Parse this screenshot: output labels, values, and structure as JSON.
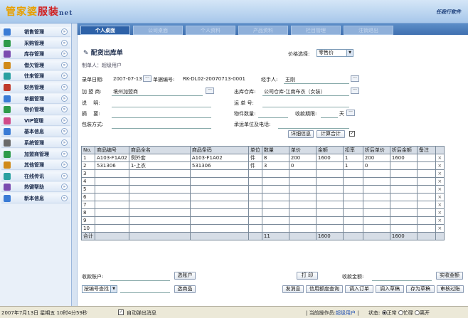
{
  "app": {
    "logo_part1": "管家婆",
    "logo_part2": "服装",
    "logo_part3": "net",
    "brand": "任我行软件"
  },
  "sidebar": {
    "items": [
      {
        "label": "销售管理",
        "icon": "sales-icon",
        "color": "#3a7bd5"
      },
      {
        "label": "采购管理",
        "icon": "purchase-icon",
        "color": "#2e9b4a"
      },
      {
        "label": "库存管理",
        "icon": "inventory-icon",
        "color": "#7a4bb0"
      },
      {
        "label": "借欠管理",
        "icon": "debt-icon",
        "color": "#d08a1a"
      },
      {
        "label": "往来管理",
        "icon": "exchange-icon",
        "color": "#2aa0a0"
      },
      {
        "label": "财务管理",
        "icon": "finance-icon",
        "color": "#c0392b"
      },
      {
        "label": "单据管理",
        "icon": "document-icon",
        "color": "#3a7bd5"
      },
      {
        "label": "物价管理",
        "icon": "price-icon",
        "color": "#2e9b4a"
      },
      {
        "label": "VIP管理",
        "icon": "vip-icon",
        "color": "#d04a8a"
      },
      {
        "label": "基本信息",
        "icon": "info-icon",
        "color": "#3a7bd5"
      },
      {
        "label": "系统管理",
        "icon": "system-icon",
        "color": "#6a6a6a"
      },
      {
        "label": "加盟商管理",
        "icon": "franchise-icon",
        "color": "#2e9b4a"
      },
      {
        "label": "其他管理",
        "icon": "other-icon",
        "color": "#d08a1a"
      },
      {
        "label": "在线传讯",
        "icon": "chat-icon",
        "color": "#2aa0a0"
      },
      {
        "label": "热键帮助",
        "icon": "help-icon",
        "color": "#7a4bb0"
      },
      {
        "label": "新本信息",
        "icon": "news-icon",
        "color": "#3a7bd5"
      }
    ]
  },
  "tabs": [
    {
      "label": "个人桌面",
      "active": true
    },
    {
      "label": "公司桌面",
      "active": false
    },
    {
      "label": "个人资料",
      "active": false
    },
    {
      "label": "产品资料",
      "active": false
    },
    {
      "label": "栏目管理",
      "active": false
    },
    {
      "label": "注销退出",
      "active": false
    }
  ],
  "form": {
    "title": "配货出库单",
    "price_label": "价格选择:",
    "price_value": "零售价",
    "creator": "制单人：超级用户",
    "date_label": "录单日期:",
    "date_value": "2007-07-13",
    "doc_no_label": "单据编号:",
    "doc_no_value": "RK-DL02-20070713-0001",
    "handler_label": "经手人:",
    "handler_value": "王刚",
    "franchise_label": "加 盟 商:",
    "franchise_value": "境州加盟商",
    "warehouse_label": "出库仓库:",
    "warehouse_value": "公司仓库-江南布衣（女装）",
    "desc_label": "说　 明:",
    "waybill_label": "运 单 号:",
    "summary_label": "摘　 要:",
    "qty_label": "物件数量:",
    "term_label": "收款期限:",
    "term_unit": "天",
    "packing_label": "包装方式:",
    "carrier_label": "承运单位及电话:",
    "detail_btn": "详细信息",
    "total_btn": "计算合计"
  },
  "grid": {
    "columns": [
      "No.",
      "商品编号",
      "商品全名",
      "商品条码",
      "单位",
      "数量",
      "单价",
      "金额",
      "扣率",
      "折后单价",
      "折后金额",
      "备注",
      ""
    ],
    "rows": [
      [
        "1",
        "A103-F1A02",
        "例外套",
        "A103-F1A02",
        "件",
        "8",
        "200",
        "1600",
        "1",
        "200",
        "1600",
        "",
        "×"
      ],
      [
        "2",
        "531306",
        "1-上衣",
        "531306",
        "件",
        "3",
        "0",
        "",
        "1",
        "0",
        "",
        "",
        "×"
      ],
      [
        "3",
        "",
        "",
        "",
        "",
        "",
        "",
        "",
        "",
        "",
        "",
        "",
        "×"
      ],
      [
        "4",
        "",
        "",
        "",
        "",
        "",
        "",
        "",
        "",
        "",
        "",
        "",
        "×"
      ],
      [
        "5",
        "",
        "",
        "",
        "",
        "",
        "",
        "",
        "",
        "",
        "",
        "",
        "×"
      ],
      [
        "6",
        "",
        "",
        "",
        "",
        "",
        "",
        "",
        "",
        "",
        "",
        "",
        "×"
      ],
      [
        "7",
        "",
        "",
        "",
        "",
        "",
        "",
        "",
        "",
        "",
        "",
        "",
        "×"
      ],
      [
        "8",
        "",
        "",
        "",
        "",
        "",
        "",
        "",
        "",
        "",
        "",
        "",
        "×"
      ],
      [
        "9",
        "",
        "",
        "",
        "",
        "",
        "",
        "",
        "",
        "",
        "",
        "",
        "×"
      ],
      [
        "10",
        "",
        "",
        "",
        "",
        "",
        "",
        "",
        "",
        "",
        "",
        "",
        "×"
      ]
    ],
    "total": [
      "合计",
      "",
      "",
      "",
      "",
      "11",
      "",
      "1600",
      "",
      "",
      "1600",
      "",
      ""
    ]
  },
  "bottom": {
    "account_label": "收款账户:",
    "select_account_btn": "选账户",
    "print_btn": "打 印",
    "amount_label": "收款金额:",
    "actual_amount_btn": "实收金额",
    "search_select": "按编号查找",
    "select_goods_btn": "选商品",
    "buttons": [
      "发消息",
      "信用额度查询",
      "调入订单",
      "调入草稿",
      "存为草稿",
      "审核过账"
    ]
  },
  "status": {
    "datetime": "2007年7月13日 星期五 10时4分59秒",
    "auto_popup": "自动弹出消息",
    "operator_label": "当前操作员:",
    "operator_value": "超级用户",
    "state_label": "状态:",
    "state_normal": "正常",
    "state_busy": "忙碌",
    "state_away": "离开"
  }
}
